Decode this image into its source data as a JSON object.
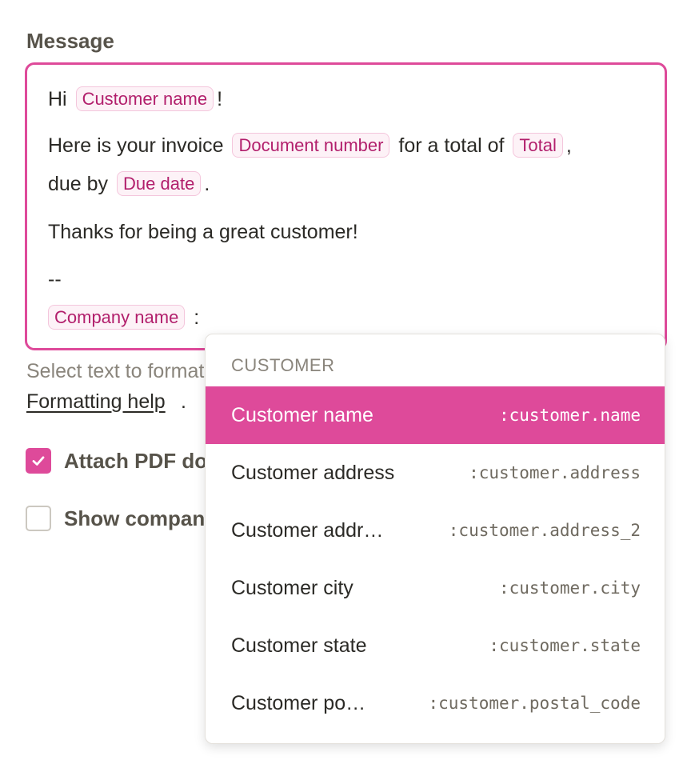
{
  "form": {
    "message_label": "Message",
    "helper_text": "Select text to format",
    "formatting_help_link": "Formatting help",
    "period": ".",
    "options": [
      {
        "label": "Attach PDF document",
        "checked": true
      },
      {
        "label": "Show company logo",
        "checked": false
      }
    ]
  },
  "editor": {
    "greeting": "Hi",
    "exclaim": "!",
    "invoice_prefix": "Here is your invoice",
    "total_prefix": "for a total of",
    "comma": ",",
    "due_prefix": "due by",
    "period": ".",
    "thanks": "Thanks for being a great customer!",
    "signature_sep": "--",
    "trigger_char": ":",
    "chips": {
      "customer_name": "Customer name",
      "document_number": "Document number",
      "total": "Total",
      "due_date": "Due date",
      "company_name": "Company name"
    }
  },
  "dropdown": {
    "section_header": "CUSTOMER",
    "items": [
      {
        "name": "Customer name",
        "code": ":customer.name",
        "active": true
      },
      {
        "name": "Customer address",
        "code": ":customer.address",
        "active": false
      },
      {
        "name": "Customer addr…",
        "code": ":customer.address_2",
        "active": false
      },
      {
        "name": "Customer city",
        "code": ":customer.city",
        "active": false
      },
      {
        "name": "Customer state",
        "code": ":customer.state",
        "active": false
      },
      {
        "name": "Customer po…",
        "code": ":customer.postal_code",
        "active": false
      }
    ]
  },
  "colors": {
    "accent": "#de4a9a",
    "chip_text": "#b21f6c",
    "chip_bg": "#fdf2f7"
  }
}
